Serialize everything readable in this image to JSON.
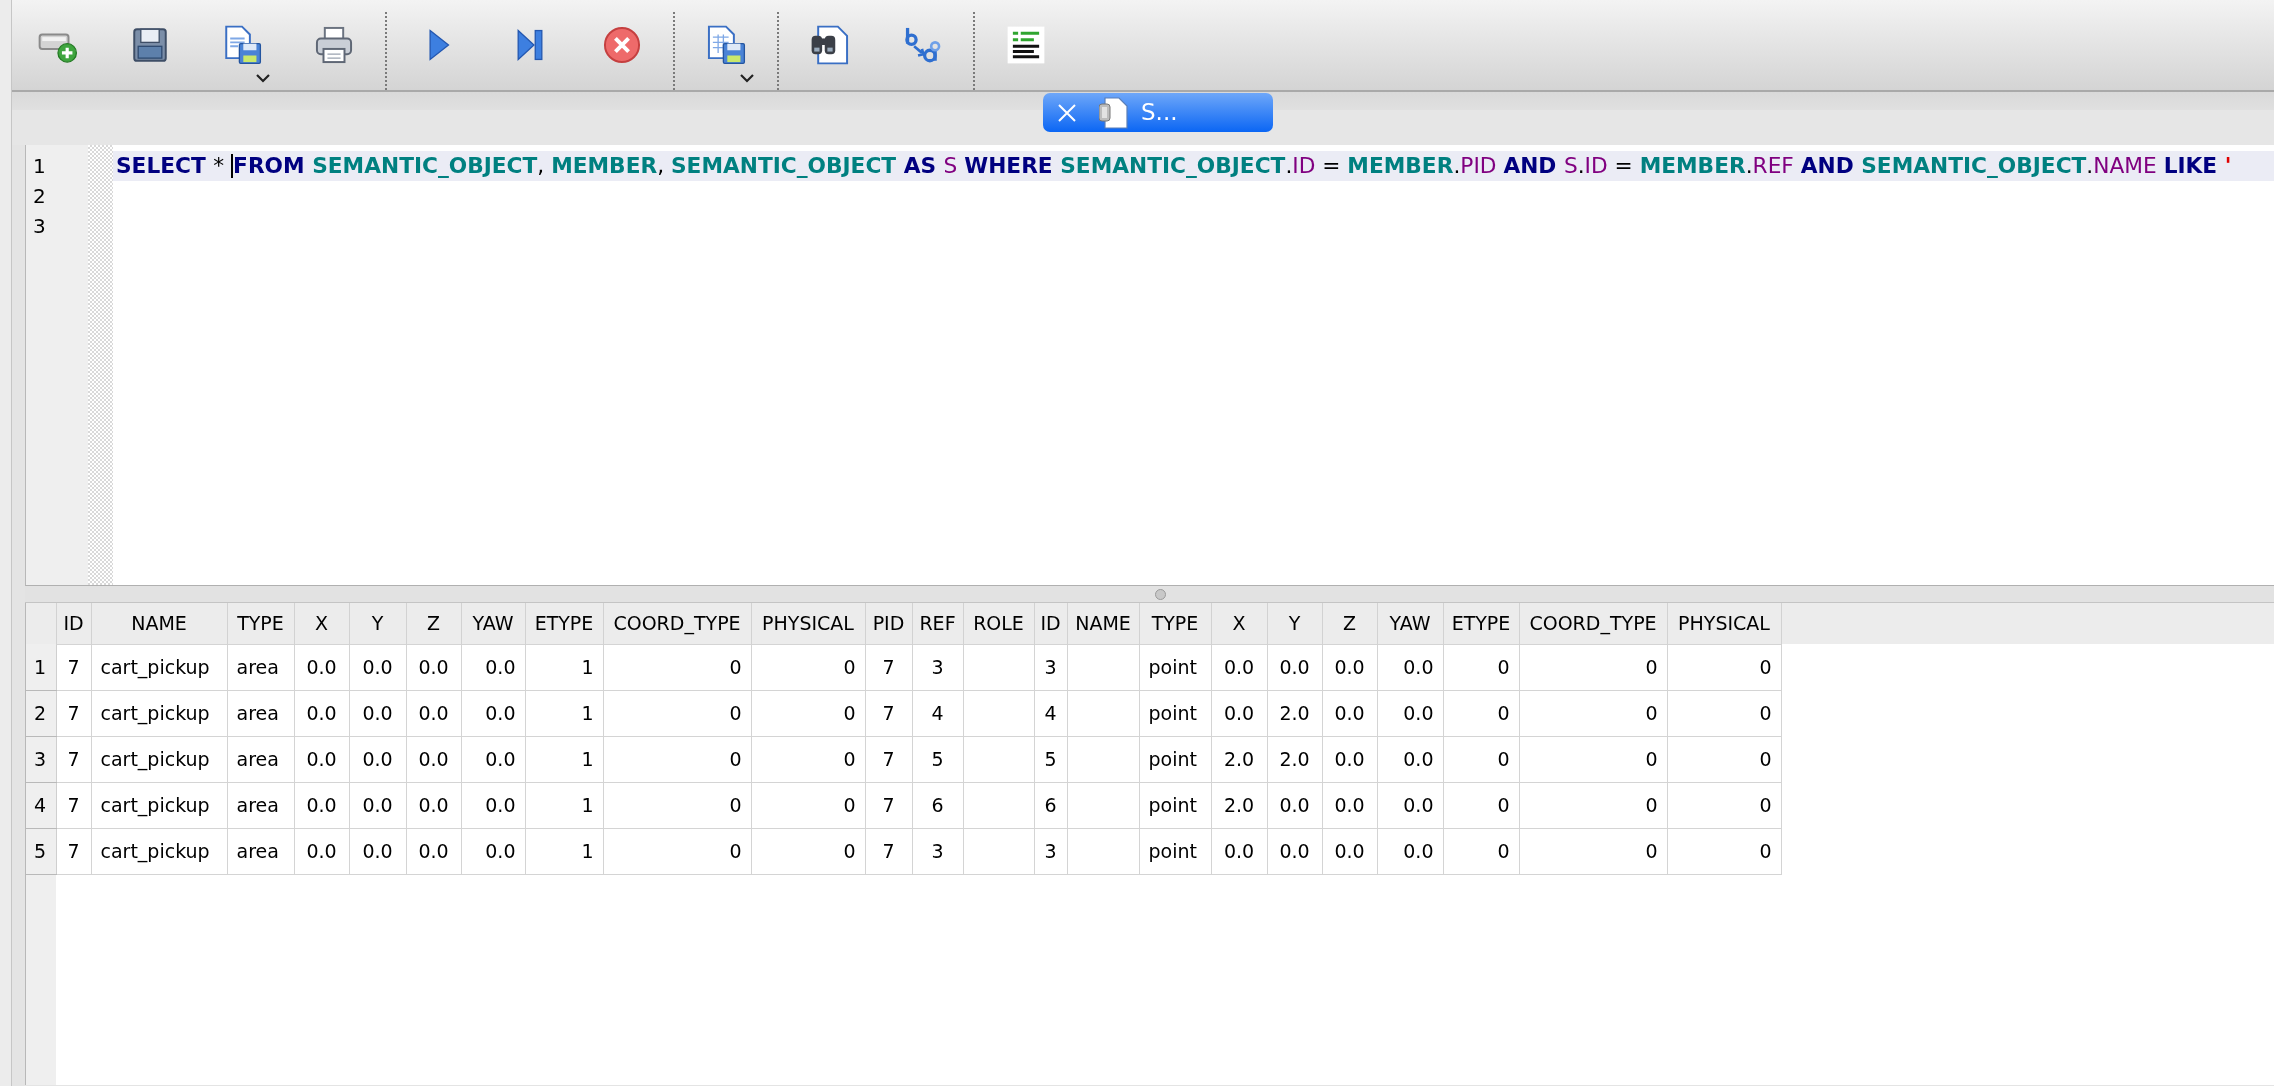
{
  "toolbar": [
    {
      "kind": "add",
      "dropdown": false
    },
    {
      "kind": "save",
      "dropdown": false
    },
    {
      "kind": "export",
      "dropdown": true
    },
    {
      "kind": "print",
      "dropdown": false
    },
    {
      "kind": "separator"
    },
    {
      "kind": "run",
      "dropdown": false
    },
    {
      "kind": "step",
      "dropdown": false
    },
    {
      "kind": "stop",
      "dropdown": false
    },
    {
      "kind": "separator"
    },
    {
      "kind": "table",
      "dropdown": true
    },
    {
      "kind": "separator"
    },
    {
      "kind": "find",
      "dropdown": false
    },
    {
      "kind": "replace",
      "dropdown": false
    },
    {
      "kind": "separator"
    },
    {
      "kind": "format",
      "dropdown": false
    }
  ],
  "tabs": [
    {
      "label": "S...",
      "selected": true
    }
  ],
  "editor": {
    "lines": [
      {
        "number": "1",
        "current": true,
        "tokens": [
          {
            "text": "SELECT ",
            "kind": "keyword"
          },
          {
            "text": "* ",
            "kind": "plain"
          },
          {
            "kind": "cursor"
          },
          {
            "text": "FROM ",
            "kind": "keyword"
          },
          {
            "text": "SEMANTIC_OBJECT",
            "kind": "table"
          },
          {
            "text": ", ",
            "kind": "plain"
          },
          {
            "text": "MEMBER",
            "kind": "table"
          },
          {
            "text": ", ",
            "kind": "plain"
          },
          {
            "text": "SEMANTIC_OBJECT ",
            "kind": "table"
          },
          {
            "text": "AS ",
            "kind": "keyword"
          },
          {
            "text": "S ",
            "kind": "column"
          },
          {
            "text": "WHERE ",
            "kind": "keyword"
          },
          {
            "text": "SEMANTIC_OBJECT",
            "kind": "table"
          },
          {
            "text": ".",
            "kind": "plain"
          },
          {
            "text": "ID ",
            "kind": "column"
          },
          {
            "text": "= ",
            "kind": "plain"
          },
          {
            "text": "MEMBER",
            "kind": "table"
          },
          {
            "text": ".",
            "kind": "plain"
          },
          {
            "text": "PID ",
            "kind": "column"
          },
          {
            "text": "AND ",
            "kind": "keyword"
          },
          {
            "text": "S",
            "kind": "column"
          },
          {
            "text": ".",
            "kind": "plain"
          },
          {
            "text": "ID ",
            "kind": "column"
          },
          {
            "text": "= ",
            "kind": "plain"
          },
          {
            "text": "MEMBER",
            "kind": "table"
          },
          {
            "text": ".",
            "kind": "plain"
          },
          {
            "text": "REF ",
            "kind": "column"
          },
          {
            "text": "AND ",
            "kind": "keyword"
          },
          {
            "text": "SEMANTIC_OBJECT",
            "kind": "table"
          },
          {
            "text": ".",
            "kind": "plain"
          },
          {
            "text": "NAME ",
            "kind": "column"
          },
          {
            "text": "LIKE ",
            "kind": "keyword"
          },
          {
            "text": "'",
            "kind": "string"
          }
        ]
      },
      {
        "number": "2",
        "current": false
      },
      {
        "number": "3",
        "current": false
      }
    ]
  },
  "results": {
    "columns": [
      "ID",
      "NAME",
      "TYPE",
      "X",
      "Y",
      "Z",
      "YAW",
      "ETYPE",
      "COORD_TYPE",
      "PHYSICAL",
      "PID",
      "REF",
      "ROLE",
      "ID",
      "NAME",
      "TYPE",
      "X",
      "Y",
      "Z",
      "YAW",
      "ETYPE",
      "COORD_TYPE",
      "PHYSICAL"
    ],
    "rows": [
      {
        "number": "1",
        "cells": [
          "7",
          "cart_pickup",
          "area",
          "0.0",
          "0.0",
          "0.0",
          "0.0",
          "1",
          "0",
          "0",
          "7",
          "3",
          null,
          "3",
          null,
          "point",
          "0.0",
          "0.0",
          "0.0",
          "0.0",
          "0",
          "0",
          "0"
        ]
      },
      {
        "number": "2",
        "cells": [
          "7",
          "cart_pickup",
          "area",
          "0.0",
          "0.0",
          "0.0",
          "0.0",
          "1",
          "0",
          "0",
          "7",
          "4",
          null,
          "4",
          null,
          "point",
          "0.0",
          "2.0",
          "0.0",
          "0.0",
          "0",
          "0",
          "0"
        ]
      },
      {
        "number": "3",
        "cells": [
          "7",
          "cart_pickup",
          "area",
          "0.0",
          "0.0",
          "0.0",
          "0.0",
          "1",
          "0",
          "0",
          "7",
          "5",
          null,
          "5",
          null,
          "point",
          "2.0",
          "2.0",
          "0.0",
          "0.0",
          "0",
          "0",
          "0"
        ]
      },
      {
        "number": "4",
        "cells": [
          "7",
          "cart_pickup",
          "area",
          "0.0",
          "0.0",
          "0.0",
          "0.0",
          "1",
          "0",
          "0",
          "7",
          "6",
          null,
          "6",
          null,
          "point",
          "2.0",
          "0.0",
          "0.0",
          "0.0",
          "0",
          "0",
          "0"
        ]
      },
      {
        "number": "5",
        "cells": [
          "7",
          "cart_pickup",
          "area",
          "0.0",
          "0.0",
          "0.0",
          "0.0",
          "1",
          "0",
          "0",
          "7",
          "3",
          null,
          "3",
          null,
          "point",
          "0.0",
          "0.0",
          "0.0",
          "0.0",
          "0",
          "0",
          "0"
        ]
      }
    ]
  }
}
